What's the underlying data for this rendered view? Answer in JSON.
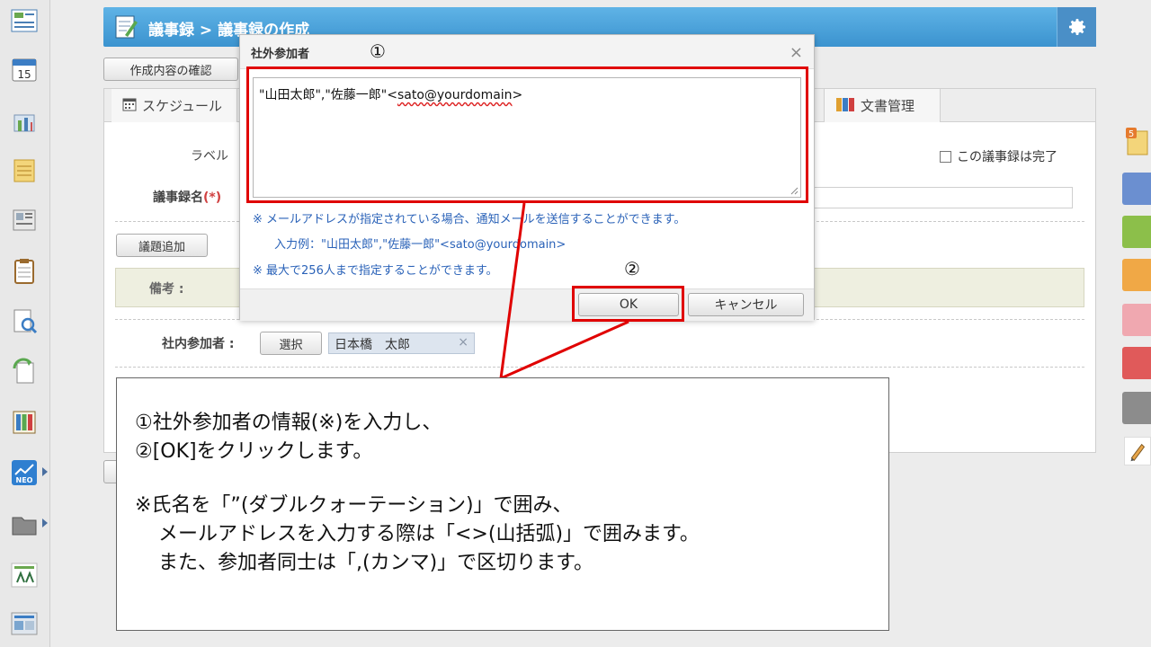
{
  "header": {
    "title": "議事録 > 議事録の作成",
    "confirm_label": "作成内容の確認"
  },
  "tabs": [
    {
      "label": "スケジュール",
      "icon": "calendar-icon"
    },
    {
      "label": "文書管理",
      "icon": "binders-icon"
    }
  ],
  "form": {
    "label_label": "ラベル",
    "name_label": "議事録名",
    "required_mark": "(*)",
    "add_topic_label": "議題追加",
    "notes_label": "備考 :",
    "internal_label": "社内参加者 :",
    "select_label": "選択",
    "internal_member": "日本橋　太郎",
    "member_remove": "×",
    "done_label": "この議事録は完了"
  },
  "dialog": {
    "title": "社外参加者",
    "close": "×",
    "textarea_prefix": "\"山田太郎\",\"佐藤一郎\"<",
    "textarea_email": "sato@yourdomain",
    "textarea_suffix": ">",
    "note1": "※ メールアドレスが指定されている場合、通知メールを送信することができます。",
    "note2": "入力例：\"山田太郎\",\"佐藤一郎\"<sato@yourdomain>",
    "note3": "※ 最大で256人まで指定することができます。",
    "ok_label": "OK",
    "cancel_label": "キャンセル"
  },
  "annotations": {
    "marker1": "①",
    "marker2": "②",
    "line1": "①社外参加者の情報(※)を入力し、",
    "line2": "②[OK]をクリックします。",
    "line3": "※氏名を「”(ダブルクォーテーション)」で囲み、",
    "line4": "メールアドレスを入力する際は「<>(山括弧)」で囲みます。",
    "line5": "また、参加者同士は「,(カンマ)」で区切ります。"
  },
  "colors": {
    "header_blue": "#3b93cf",
    "highlight_red": "#e00000",
    "note_blue": "#2a62b8"
  }
}
